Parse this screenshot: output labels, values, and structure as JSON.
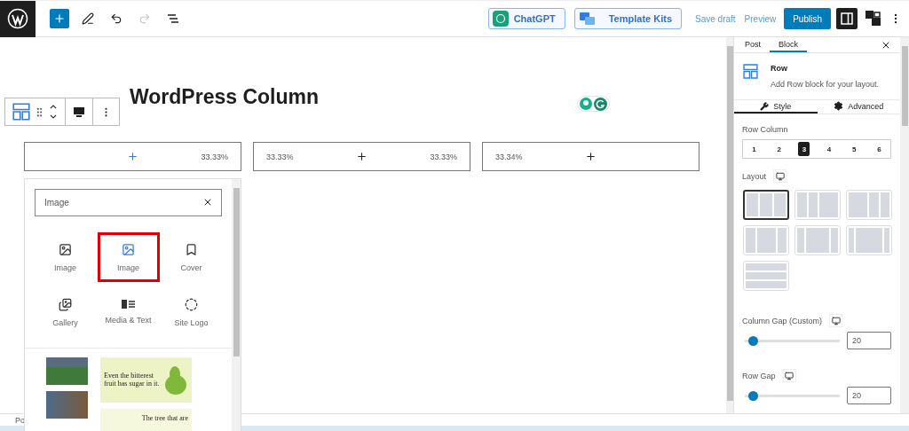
{
  "top_bar": {
    "tools": [
      {
        "kind": "add",
        "disabled": false
      },
      {
        "kind": "edit",
        "disabled": false
      },
      {
        "kind": "undo",
        "disabled": false
      },
      {
        "kind": "redo",
        "disabled": true
      },
      {
        "kind": "list-view",
        "disabled": false
      }
    ],
    "chatgpt_button": "ChatGPT",
    "template_kits_button": "Template Kits",
    "save_draft": "Save draft",
    "preview": "Preview",
    "publish": "Publish",
    "settings_toggle": {
      "pressed": true
    }
  },
  "editor": {
    "title": "WordPress Column",
    "columns": [
      {
        "end_label": "33.33%",
        "selected": true
      },
      {
        "start_label": "33.33%",
        "end_label": "33.33%",
        "selected": false
      },
      {
        "start_label": "33.34%",
        "selected": false
      }
    ]
  },
  "inserter": {
    "search": {
      "value": "Image"
    },
    "results": [
      {
        "label": "Image",
        "kind": "image",
        "highlighted": false
      },
      {
        "label": "Image",
        "kind": "image-alt",
        "highlighted": true
      },
      {
        "label": "Cover",
        "kind": "cover",
        "highlighted": false
      },
      {
        "label": "Gallery",
        "kind": "gallery",
        "highlighted": false
      },
      {
        "label": "Media & Text",
        "kind": "media-text",
        "highlighted": false
      },
      {
        "label": "Site Logo",
        "kind": "site-logo",
        "highlighted": false
      }
    ],
    "patterns": {
      "quote": "Even the bitterest fruit has sugar in it.",
      "caption": "The tree that are"
    }
  },
  "sidebar": {
    "tabs": [
      {
        "label": "Post",
        "selected": false
      },
      {
        "label": "Block",
        "selected": true
      }
    ],
    "block": {
      "name": "Row",
      "description": "Add Row block for your layout."
    },
    "panel_tabs": [
      {
        "label": "Style",
        "kind": "style",
        "selected": true
      },
      {
        "label": "Advanced",
        "kind": "advanced",
        "selected": false
      }
    ],
    "row_column": {
      "label": "Row Column",
      "options": [
        {
          "label": "1",
          "selected": false
        },
        {
          "label": "2",
          "selected": false
        },
        {
          "label": "3",
          "selected": true
        },
        {
          "label": "4",
          "selected": false
        },
        {
          "label": "5",
          "selected": false
        },
        {
          "label": "6",
          "selected": false
        }
      ]
    },
    "layout": {
      "label": "Layout",
      "options": [
        {
          "kind": "thirds",
          "selected": true
        },
        {
          "kind": "narrow-narrow-wide",
          "selected": false
        },
        {
          "kind": "wide-narrow-narrow",
          "selected": false
        },
        {
          "kind": "narrow-wide-narrow",
          "selected": false
        },
        {
          "kind": "narrow-wider-narrow",
          "selected": false
        },
        {
          "kind": "narrow-widest-narrow",
          "selected": false
        },
        {
          "kind": "stacked",
          "selected": false
        }
      ]
    },
    "column_gap": {
      "label": "Column Gap (Custom)",
      "level": 0.08,
      "value": "20"
    },
    "row_gap": {
      "label": "Row Gap",
      "level": 0.08,
      "value": "20"
    }
  },
  "footer": {
    "breadcrumb": "Po"
  }
}
